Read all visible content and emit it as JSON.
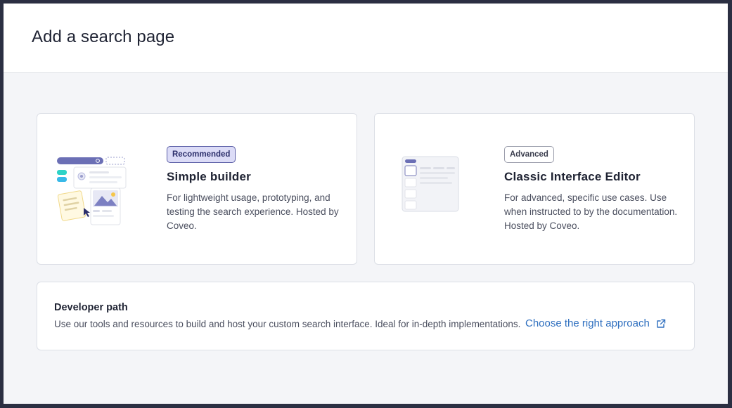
{
  "modal": {
    "title": "Add a search page"
  },
  "cards": {
    "simple": {
      "badge": "Recommended",
      "title": "Simple builder",
      "description": "For lightweight usage, prototyping, and testing the search experience. Hosted by Coveo.",
      "illustration_icon": "search-page-builder-illustration-icon"
    },
    "classic": {
      "badge": "Advanced",
      "title": "Classic Interface Editor",
      "description": "For advanced, specific use cases. Use when instructed to by the documentation. Hosted by Coveo.",
      "illustration_icon": "interface-editor-illustration-icon"
    }
  },
  "developer": {
    "title": "Developer path",
    "description": "Use our tools and resources to build and host your custom search interface. Ideal for in-depth implementations.",
    "link_label": "Choose the right approach",
    "link_icon": "external-link-icon"
  },
  "colors": {
    "accent": "#6b6fb5",
    "link": "#2e6fbf",
    "badge_recommended_bg": "#dcdcf7",
    "backdrop": "#2b2f42"
  }
}
